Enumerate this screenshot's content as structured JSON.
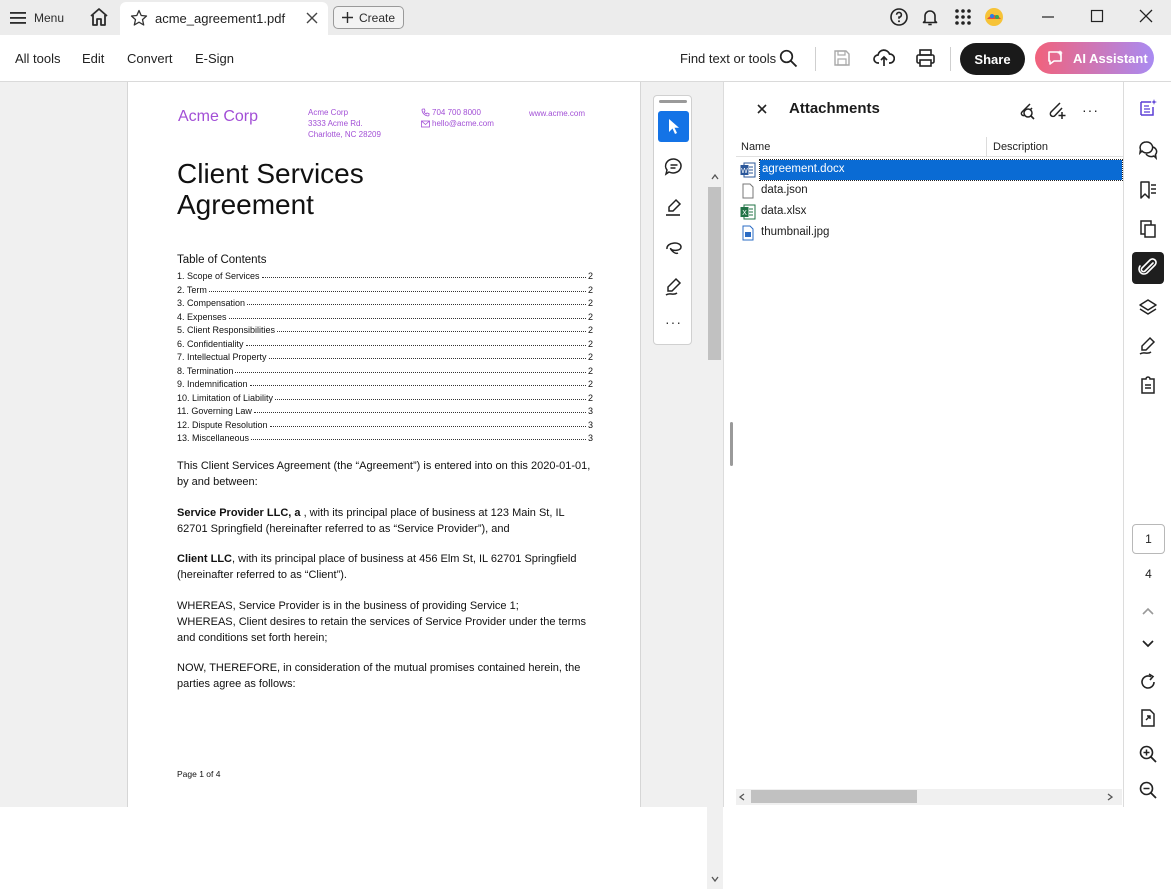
{
  "titlebar": {
    "menu_label": "Menu",
    "tab_title": "acme_agreement1.pdf",
    "create_label": "Create"
  },
  "toolbar": {
    "items": [
      "All tools",
      "Edit",
      "Convert",
      "E-Sign"
    ],
    "find_label": "Find text or tools",
    "share_label": "Share",
    "ai_label": "AI Assistant"
  },
  "document": {
    "brand": "Acme Corp",
    "address_lines": [
      "Acme Corp",
      "3333 Acme Rd.",
      "Charlotte, NC 28209"
    ],
    "phone": "704 700 8000",
    "email": "hello@acme.com",
    "website": "www.acme.com",
    "title_line1": "Client Services",
    "title_line2": "Agreement",
    "toc_title": "Table of Contents",
    "toc": [
      {
        "label": "1. Scope of Services",
        "page": "2"
      },
      {
        "label": "2. Term",
        "page": "2"
      },
      {
        "label": "3. Compensation",
        "page": "2"
      },
      {
        "label": "4. Expenses",
        "page": "2"
      },
      {
        "label": "5. Client Responsibilities",
        "page": "2"
      },
      {
        "label": "6. Confidentiality",
        "page": "2"
      },
      {
        "label": "7. Intellectual Property",
        "page": "2"
      },
      {
        "label": "8. Termination",
        "page": "2"
      },
      {
        "label": "9. Indemnification",
        "page": "2"
      },
      {
        "label": "10. Limitation of Liability",
        "page": "2"
      },
      {
        "label": "11. Governing Law",
        "page": "3"
      },
      {
        "label": "12. Dispute Resolution",
        "page": "3"
      },
      {
        "label": "13. Miscellaneous",
        "page": "3"
      }
    ],
    "para1": "This Client Services Agreement (the “Agreement”) is entered into on this 2020-01-01, by and between:",
    "para2_bold": "Service Provider LLC, a ",
    "para2_rest": " , with its principal place of business at 123 Main St, IL 62701 Springfield (hereinafter referred to as “Service Provider”), and",
    "para3_bold": "Client LLC",
    "para3_rest": ", with its principal place of business at 456 Elm St, IL 62701 Springfield (hereinafter referred to as “Client”).",
    "para4a": "WHEREAS, Service Provider is in the business of providing Service 1;",
    "para4b": "WHEREAS, Client desires to retain the services of Service Provider under the terms and conditions set forth herein;",
    "para5": "NOW, THEREFORE, in consideration of the mutual promises contained herein, the parties agree as follows:",
    "footer": "Page 1 of 4"
  },
  "attachments": {
    "title": "Attachments",
    "col_name": "Name",
    "col_description": "Description",
    "files": [
      {
        "name": "agreement.docx",
        "icon": "word-file-icon"
      },
      {
        "name": "data.json",
        "icon": "blank-file-icon"
      },
      {
        "name": "data.xlsx",
        "icon": "excel-file-icon"
      },
      {
        "name": "thumbnail.jpg",
        "icon": "image-file-icon"
      }
    ],
    "selected_index": 0
  },
  "navigation": {
    "current_page": "1",
    "total_pages": "4"
  },
  "colors": {
    "accent": "#1473e6",
    "brand_purple": "#a24fd6",
    "selection": "#0a6bd4"
  }
}
